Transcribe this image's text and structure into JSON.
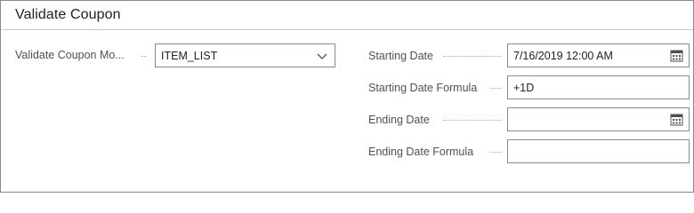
{
  "section": {
    "title": "Validate Coupon"
  },
  "left": {
    "mode_label": "Validate Coupon Mo...",
    "mode_value": "ITEM_LIST"
  },
  "right": {
    "starting_date_label": "Starting Date",
    "starting_date_value": "7/16/2019 12:00 AM",
    "starting_formula_label": "Starting Date Formula",
    "starting_formula_value": "+1D",
    "ending_date_label": "Ending Date",
    "ending_date_value": "",
    "ending_formula_label": "Ending Date  Formula",
    "ending_formula_value": ""
  },
  "icons": {
    "dropdown": "chevron-down-icon",
    "calendar": "calendar-icon"
  }
}
